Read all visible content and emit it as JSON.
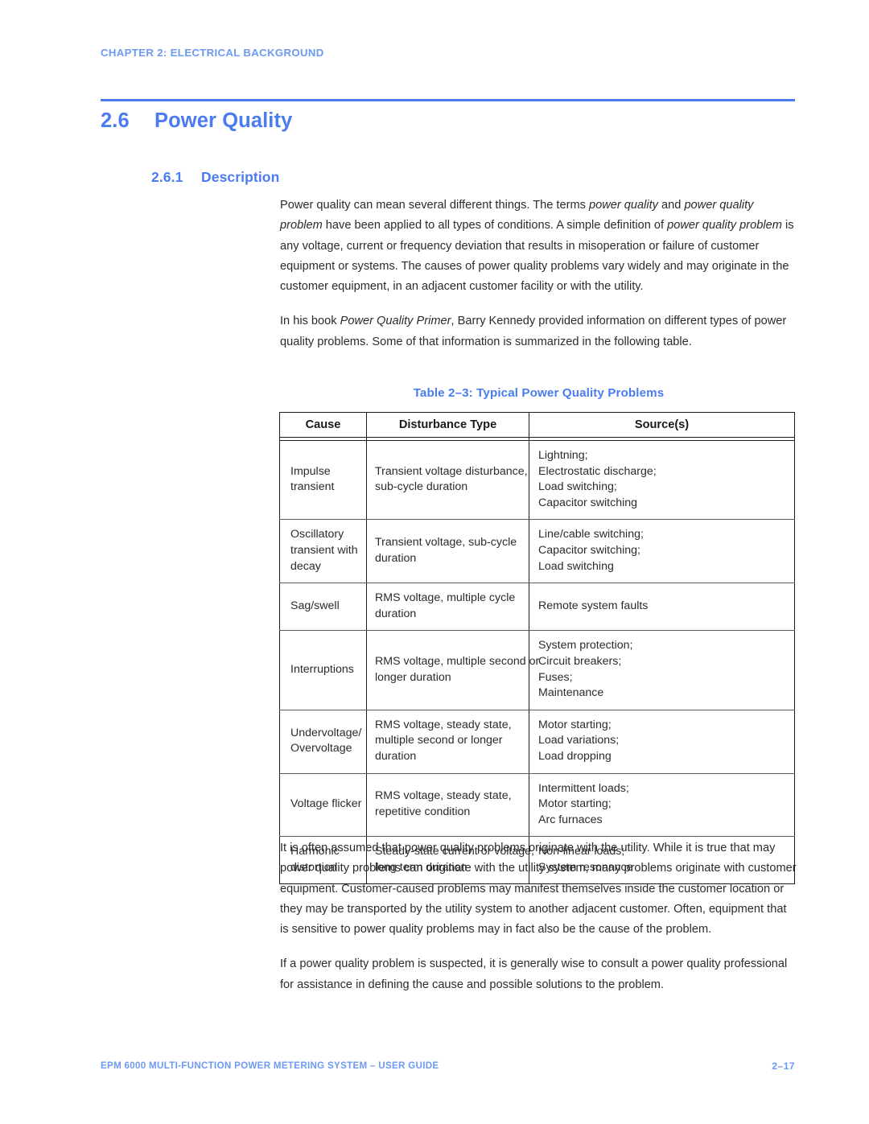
{
  "header": {
    "chapter_label": "CHAPTER 2: ELECTRICAL BACKGROUND",
    "rule_color": "#4a7cf0",
    "accent_color": "#4a7cf0"
  },
  "section": {
    "number": "2.6",
    "title": "Power Quality"
  },
  "subsection": {
    "number": "2.6.1",
    "title": "Description"
  },
  "paragraphs_top": [
    {
      "id": "p1",
      "runs": [
        {
          "text": "Power quality can mean several different things. The terms ",
          "style": "normal"
        },
        {
          "text": "power quality",
          "style": "italic"
        },
        {
          "text": " and ",
          "style": "normal"
        },
        {
          "text": "power quality problem",
          "style": "italic"
        },
        {
          "text": " have been applied to all types of conditions. A simple definition of ",
          "style": "normal"
        },
        {
          "text": "power quality problem",
          "style": "italic"
        },
        {
          "text": " is any voltage, current or frequency deviation that results in misoperation or failure of customer equipment or systems. The causes of power quality problems vary widely and may originate in the customer equipment, in an adjacent customer facility or with the utility.",
          "style": "normal"
        }
      ]
    },
    {
      "id": "p2",
      "runs": [
        {
          "text": "In his book ",
          "style": "normal"
        },
        {
          "text": "Power Quality Primer",
          "style": "italic"
        },
        {
          "text": ", Barry Kennedy provided information on different types of power quality problems. Some of that information is summarized in the following table.",
          "style": "normal"
        }
      ]
    }
  ],
  "table": {
    "caption": "Table 2–3: Typical Power Quality Problems",
    "columns": [
      "Cause",
      "Disturbance Type",
      "Source(s)"
    ],
    "rows": [
      {
        "cause": [
          "Impulse",
          "transient"
        ],
        "disturbance": [
          "Transient voltage disturbance,",
          "sub-cycle duration"
        ],
        "sources": [
          "Lightning;",
          "Electrostatic discharge;",
          "Load switching;",
          "Capacitor switching"
        ]
      },
      {
        "cause": [
          "Oscillatory",
          "transient with",
          "decay"
        ],
        "disturbance": [
          "Transient voltage, sub-cycle",
          "duration"
        ],
        "sources": [
          "Line/cable switching;",
          "Capacitor switching;",
          "Load switching"
        ]
      },
      {
        "cause": [
          "Sag/swell"
        ],
        "disturbance": [
          "RMS voltage, multiple cycle",
          "duration"
        ],
        "sources": [
          "Remote system faults"
        ]
      },
      {
        "cause": [
          "Interruptions"
        ],
        "disturbance": [
          "RMS voltage, multiple second or",
          "longer duration"
        ],
        "sources": [
          "System protection;",
          "Circuit breakers;",
          "Fuses;",
          "Maintenance"
        ]
      },
      {
        "cause": [
          "Undervoltage/",
          "Overvoltage"
        ],
        "disturbance": [
          "RMS voltage, steady state,",
          "multiple second or longer",
          "duration"
        ],
        "sources": [
          "Motor starting;",
          "Load variations;",
          "Load dropping"
        ]
      },
      {
        "cause": [
          "Voltage flicker"
        ],
        "disturbance": [
          "RMS voltage, steady state,",
          "repetitive condition"
        ],
        "sources": [
          "Intermittent loads;",
          "Motor starting;",
          "Arc furnaces"
        ]
      },
      {
        "cause": [
          "Harmonic",
          "distortion"
        ],
        "disturbance": [
          "Steady-state current or voltage,",
          "long term duration"
        ],
        "sources": [
          "Non-linear loads;",
          "System resonance"
        ]
      }
    ]
  },
  "paragraphs_bottom": [
    {
      "id": "p3",
      "runs": [
        {
          "text": "It is often assumed that power quality problems originate with the utility. While it is true that may power quality problems can originate with the utility system, many problems originate with customer equipment. Customer-caused problems may manifest themselves inside the customer location or they may be transported by the utility system to another adjacent customer. Often, equipment that is sensitive to power quality problems may in fact also be the cause of the problem.",
          "style": "normal"
        }
      ]
    },
    {
      "id": "p4",
      "runs": [
        {
          "text": "If a power quality problem is suspected, it is generally wise to consult a power quality professional for assistance in defining the cause and possible solutions to the problem.",
          "style": "normal"
        }
      ]
    }
  ],
  "footer": {
    "left": "EPM 6000 MULTI-FUNCTION POWER METERING SYSTEM – USER GUIDE",
    "page_number": "2–17"
  }
}
